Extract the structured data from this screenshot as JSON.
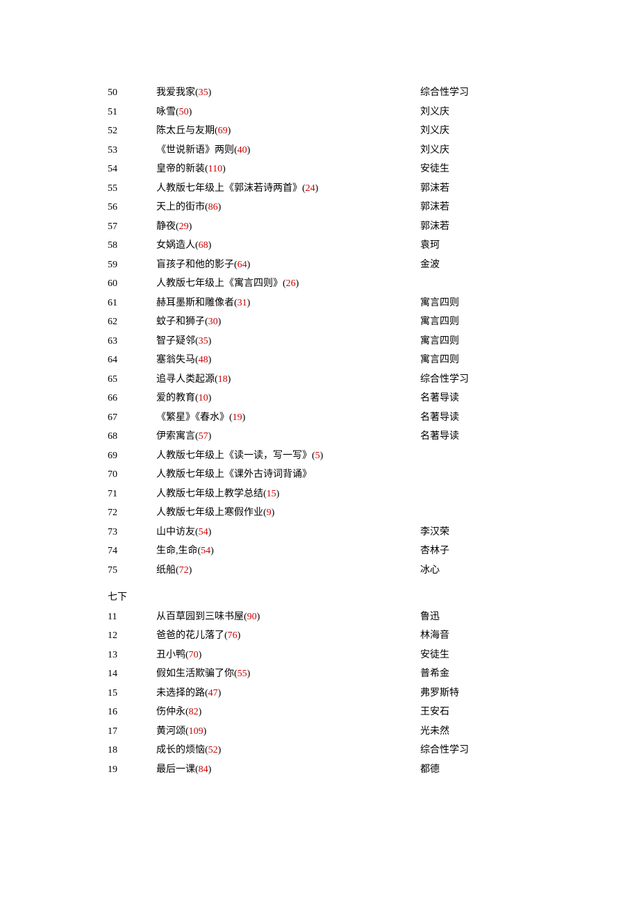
{
  "sections": [
    {
      "header": "",
      "rows": [
        {
          "num": "50",
          "title_a": "我爱我家(",
          "count": "35",
          "title_b": ")",
          "author": "综合性学习"
        },
        {
          "num": "51",
          "title_a": "咏雪(",
          "count": "50",
          "title_b": ")",
          "author": "刘义庆"
        },
        {
          "num": "52",
          "title_a": "陈太丘与友期(",
          "count": "69",
          "title_b": ")",
          "author": "刘义庆"
        },
        {
          "num": "53",
          "title_a": "《世说新语》两则(",
          "count": "40",
          "title_b": ")",
          "author": "刘义庆"
        },
        {
          "num": "54",
          "title_a": "皇帝的新装(",
          "count": "110",
          "title_b": ")",
          "author": "安徒生"
        },
        {
          "num": "55",
          "title_a": "人教版七年级上《郭沫若诗两首》(",
          "count": "24",
          "title_b": ")",
          "author": "郭沫若"
        },
        {
          "num": "56",
          "title_a": "天上的街市(",
          "count": "86",
          "title_b": ")",
          "author": "郭沫若"
        },
        {
          "num": "57",
          "title_a": "静夜(",
          "count": "29",
          "title_b": ")",
          "author": "郭沫若"
        },
        {
          "num": "58",
          "title_a": "女娲造人(",
          "count": "68",
          "title_b": ")",
          "author": "袁珂"
        },
        {
          "num": "59",
          "title_a": "盲孩子和他的影子(",
          "count": "64",
          "title_b": ")",
          "author": "金波"
        },
        {
          "num": "60",
          "title_a": "人教版七年级上《寓言四则》(",
          "count": "26",
          "title_b": ")",
          "author": ""
        },
        {
          "num": "61",
          "title_a": "赫耳墨斯和雕像者(",
          "count": "31",
          "title_b": ")",
          "author": "寓言四则"
        },
        {
          "num": "62",
          "title_a": "蚊子和狮子(",
          "count": "30",
          "title_b": ")",
          "author": "寓言四则"
        },
        {
          "num": "63",
          "title_a": "智子疑邻(",
          "count": "35",
          "title_b": ")",
          "author": "寓言四则"
        },
        {
          "num": "64",
          "title_a": "塞翁失马(",
          "count": "48",
          "title_b": ")",
          "author": "寓言四则"
        },
        {
          "num": "65",
          "title_a": "追寻人类起源(",
          "count": "18",
          "title_b": ")",
          "author": "综合性学习"
        },
        {
          "num": "66",
          "title_a": "爱的教育(",
          "count": "10",
          "title_b": ")",
          "author": "名著导读"
        },
        {
          "num": "67",
          "title_a": "《繁星》《春水》(",
          "count": "19",
          "title_b": ")",
          "author": "名著导读"
        },
        {
          "num": "68",
          "title_a": "伊索寓言(",
          "count": "57",
          "title_b": ")",
          "author": "名著导读"
        },
        {
          "num": "69",
          "title_a": "人教版七年级上《读一读，写一写》(",
          "count": "5",
          "title_b": ")",
          "author": ""
        },
        {
          "num": "70",
          "title_a": "人教版七年级上《课外古诗词背诵》",
          "count": "",
          "title_b": "",
          "author": ""
        },
        {
          "num": "71",
          "title_a": "人教版七年级上教学总结(",
          "count": "15",
          "title_b": ")",
          "author": ""
        },
        {
          "num": "72",
          "title_a": "人教版七年级上寒假作业(",
          "count": "9",
          "title_b": ")",
          "author": ""
        },
        {
          "num": "73",
          "title_a": "山中访友(",
          "count": "54",
          "title_b": ")",
          "author": "李汉荣"
        },
        {
          "num": "74",
          "title_a": "生命,生命(",
          "count": "54",
          "title_b": ")",
          "author": "杏林子"
        },
        {
          "num": "75",
          "title_a": "纸船(",
          "count": "72",
          "title_b": ")",
          "author": "冰心"
        }
      ]
    },
    {
      "header": "七下",
      "rows": [
        {
          "num": "11",
          "title_a": "从百草园到三味书屋(",
          "count": "90",
          "title_b": ")",
          "author": "鲁迅"
        },
        {
          "num": "12",
          "title_a": "爸爸的花儿落了(",
          "count": "76",
          "title_b": ")",
          "author": "林海音"
        },
        {
          "num": "13",
          "title_a": "丑小鸭(",
          "count": "70",
          "title_b": ")",
          "author": "安徒生"
        },
        {
          "num": "14",
          "title_a": "假如生活欺骗了你(",
          "count": "55",
          "title_b": ")",
          "author": "普希金"
        },
        {
          "num": "15",
          "title_a": "未选择的路(",
          "count": "47",
          "title_b": ")",
          "author": "弗罗斯特"
        },
        {
          "num": "16",
          "title_a": "伤仲永(",
          "count": "82",
          "title_b": ")",
          "author": "王安石"
        },
        {
          "num": "17",
          "title_a": "黄河颂(",
          "count": "109",
          "title_b": ")",
          "author": "光未然"
        },
        {
          "num": "18",
          "title_a": "成长的烦恼(",
          "count": "52",
          "title_b": ")",
          "author": "综合性学习"
        },
        {
          "num": "19",
          "title_a": "最后一课(",
          "count": "84",
          "title_b": ")",
          "author": "都德"
        }
      ]
    }
  ]
}
